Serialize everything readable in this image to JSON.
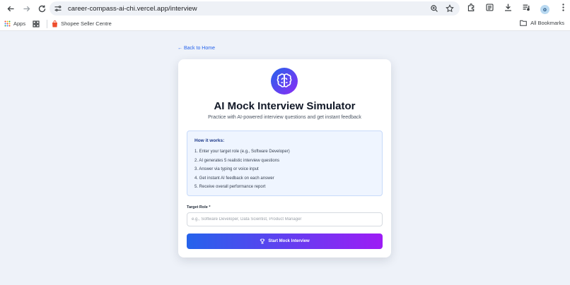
{
  "browser": {
    "url": "career-compass-ai-chi.vercel.app/interview",
    "avatar_letter": "o"
  },
  "bookmarks": {
    "apps_label": "Apps",
    "shopee_label": "Shopee Seller Centre",
    "all_bookmarks_label": "All Bookmarks"
  },
  "page": {
    "back_link": "Back to Home",
    "title": "AI Mock Interview Simulator",
    "subtitle": "Practice with AI-powered interview questions and get instant feedback",
    "how_it_works": {
      "title": "How it works:",
      "steps": [
        "1. Enter your target role (e.g., Software Developer)",
        "2. AI generates 5 realistic interview questions",
        "3. Answer via typing or voice input",
        "4. Get instant AI feedback on each answer",
        "5. Receive overall performance report"
      ]
    },
    "target_role": {
      "label": "Target Role *",
      "value": "",
      "placeholder": "e.g., Software Developer, Data Scientist, Product Manager"
    },
    "start_button": "Start Mock Interview"
  },
  "colors": {
    "accent_start": "#2563eb",
    "accent_end": "#9d1cf5",
    "page_bg": "#eef2f9"
  }
}
